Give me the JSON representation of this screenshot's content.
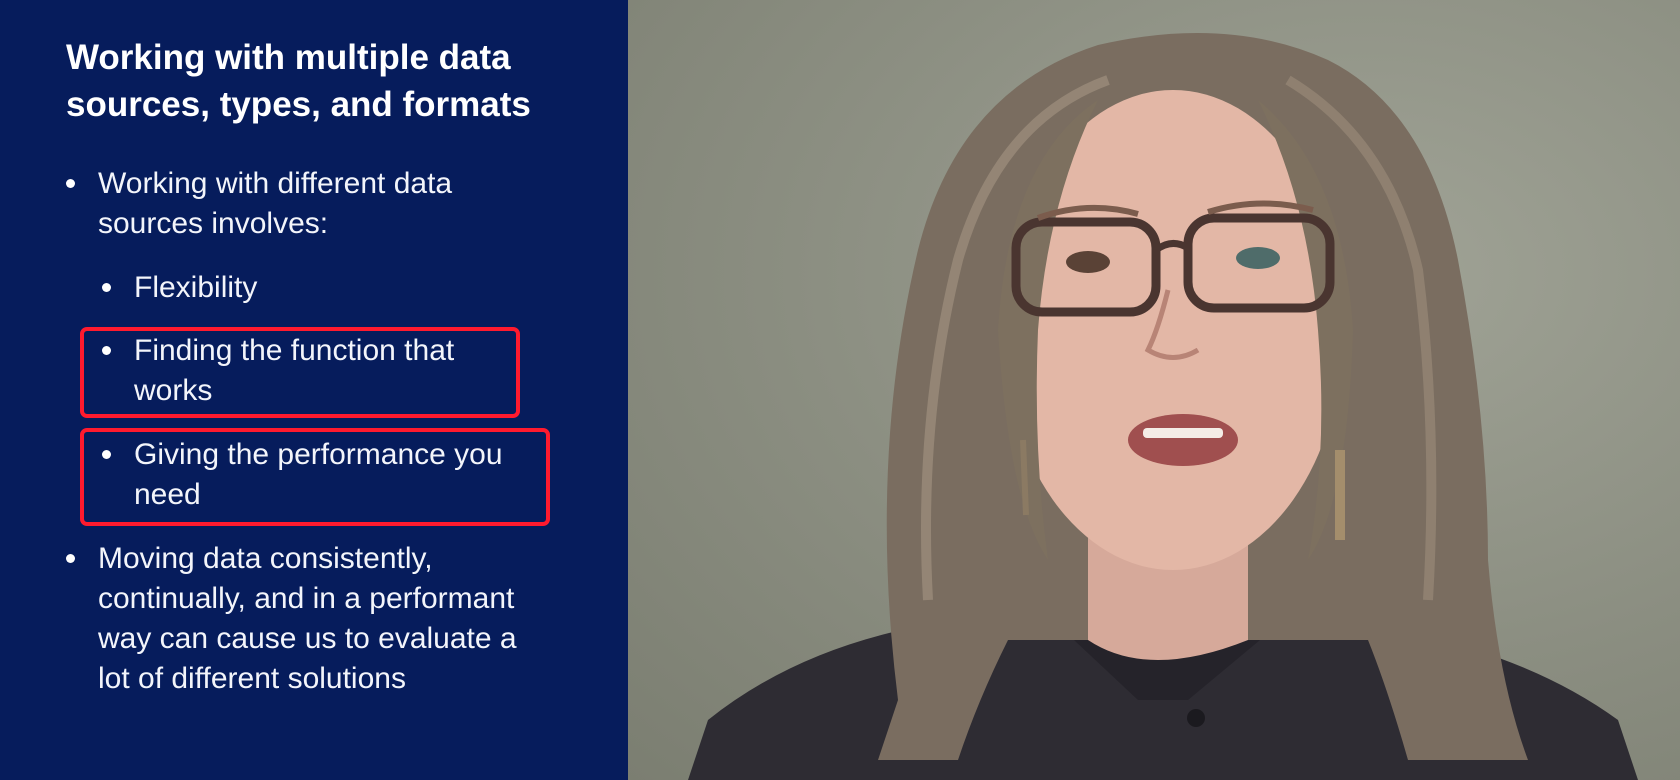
{
  "slide": {
    "title_line1": "Working with multiple data",
    "title_line2": "sources, types, and formats",
    "bullets": [
      {
        "line1": "Working with different data",
        "line2": "sources involves:"
      },
      {
        "line1": "Flexibility"
      },
      {
        "line1": "Finding the function that",
        "line2": "works",
        "highlighted": true
      },
      {
        "line1": "Giving the performance you",
        "line2": "need",
        "highlighted": true
      },
      {
        "line1": "Moving data consistently,",
        "line2": "continually, and in a performant",
        "line3": "way can cause us to evaluate a",
        "line4": "lot of different solutions"
      }
    ],
    "colors": {
      "background": "#061c5c",
      "text": "#ffffff",
      "highlight_border": "#ff1a2e"
    }
  },
  "video": {
    "description_icon": "presenter-video-icon",
    "wall_color": "#8e9285"
  }
}
